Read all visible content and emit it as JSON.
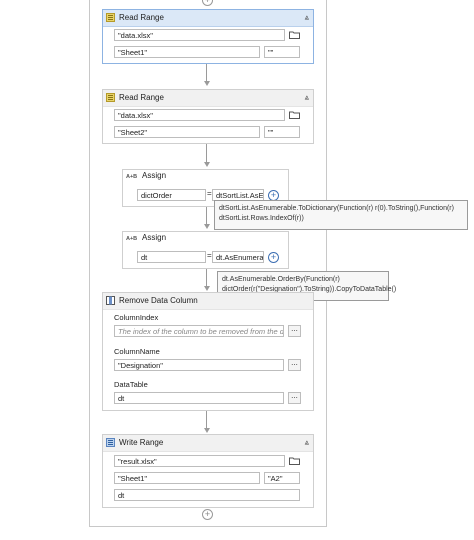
{
  "read_range_1": {
    "title": "Read Range",
    "workbook": "\"data.xlsx\"",
    "sheet": "\"Sheet1\"",
    "range": "\"\""
  },
  "read_range_2": {
    "title": "Read Range",
    "workbook": "\"data.xlsx\"",
    "sheet": "\"Sheet2\"",
    "range": "\"\""
  },
  "assign_1": {
    "title": "Assign",
    "badge": "A+B",
    "to": "dictOrder",
    "value": "dtSortList.AsEr",
    "tooltip": "dtSortList.AsEnumerable.ToDictionary(Function(r) r(0).ToString(),Function(r) dtSortList.Rows.IndexOf(r))"
  },
  "assign_2": {
    "title": "Assign",
    "badge": "A+B",
    "to": "dt",
    "value": "dt.AsEnumerabl",
    "tooltip": "dt.AsEnumerable.OrderBy(Function(r) dictOrder(r(\"Designation\").ToString)).CopyToDataTable()"
  },
  "remove_column": {
    "title": "Remove Data Column",
    "column_index_label": "ColumnIndex",
    "column_index_placeholder": "The index of the column to be removed from the d",
    "column_name_label": "ColumnName",
    "column_name_value": "\"Designation\"",
    "datatable_label": "DataTable",
    "datatable_value": "dt"
  },
  "write_range": {
    "title": "Write Range",
    "workbook": "\"result.xlsx\"",
    "sheet": "\"Sheet1\"",
    "cell": "\"A2\"",
    "datatable": "dt"
  },
  "icons": {
    "add": "+",
    "collapse": "chevron-double-up",
    "browse": "..."
  }
}
